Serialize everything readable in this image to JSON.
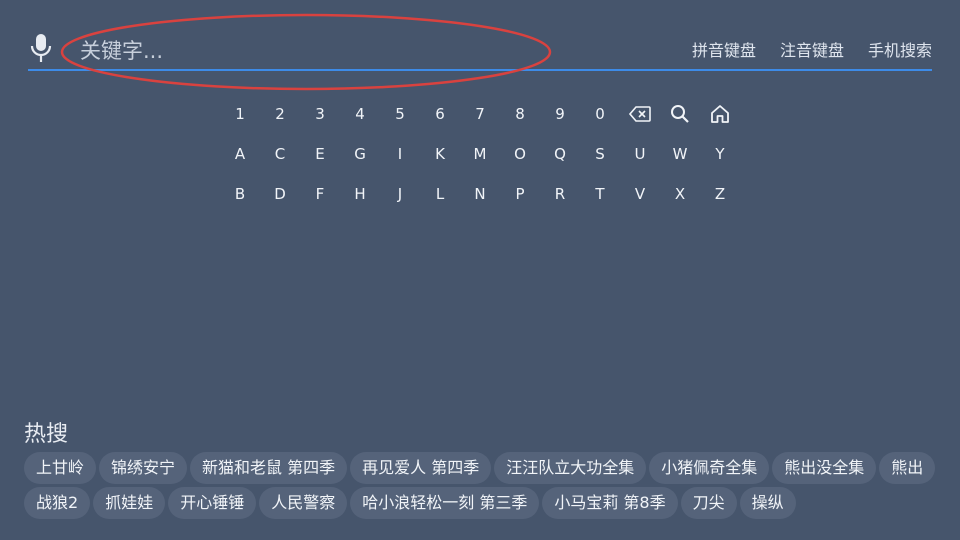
{
  "search": {
    "placeholder": "关键字..."
  },
  "keyboard_modes": [
    "拼音键盘",
    "注音键盘",
    "手机搜索"
  ],
  "keyboard": {
    "row1": [
      "1",
      "2",
      "3",
      "4",
      "5",
      "6",
      "7",
      "8",
      "9",
      "0"
    ],
    "row2": [
      "A",
      "C",
      "E",
      "G",
      "I",
      "K",
      "M",
      "O",
      "Q",
      "S",
      "U",
      "W",
      "Y"
    ],
    "row3": [
      "B",
      "D",
      "F",
      "H",
      "J",
      "L",
      "N",
      "P",
      "R",
      "T",
      "V",
      "X",
      "Z"
    ],
    "row1_icons": [
      "backspace-icon",
      "search-icon",
      "home-icon"
    ]
  },
  "hot": {
    "title": "热搜",
    "row1": [
      "上甘岭",
      "锦绣安宁",
      "新猫和老鼠 第四季",
      "再见爱人 第四季",
      "汪汪队立大功全集",
      "小猪佩奇全集",
      "熊出没全集",
      "熊出"
    ],
    "row2": [
      "战狼2",
      "抓娃娃",
      "开心锤锤",
      "人民警察",
      "哈小浪轻松一刻 第三季",
      "小马宝莉 第8季",
      "刀尖",
      "操纵"
    ]
  },
  "colors": {
    "background": "#46556c",
    "accent": "#3d8be8",
    "annotation": "#d9423f",
    "chip": "#55637a"
  }
}
